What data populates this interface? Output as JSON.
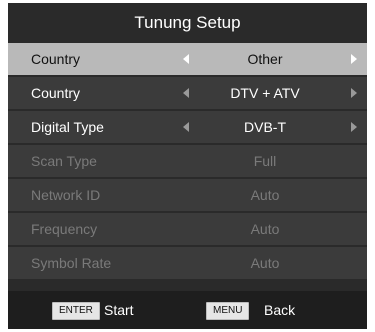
{
  "title": "Tunung Setup",
  "rows": [
    {
      "label": "Country",
      "value": "Other"
    },
    {
      "label": "Country",
      "value": "DTV + ATV"
    },
    {
      "label": "Digital Type",
      "value": "DVB-T"
    },
    {
      "label": "Scan Type",
      "value": "Full"
    },
    {
      "label": "Network ID",
      "value": "Auto"
    },
    {
      "label": "Frequency",
      "value": "Auto"
    },
    {
      "label": "Symbol Rate",
      "value": "Auto"
    }
  ],
  "footer": {
    "enter_key": "ENTER",
    "enter_label": "Start",
    "menu_key": "MENU",
    "menu_label": "Back"
  },
  "colors": {
    "panel": "#2a2a2a",
    "row": "#3b3b3b",
    "selected_row": "#b9b9b9",
    "disabled_text": "#7a7a7a"
  }
}
